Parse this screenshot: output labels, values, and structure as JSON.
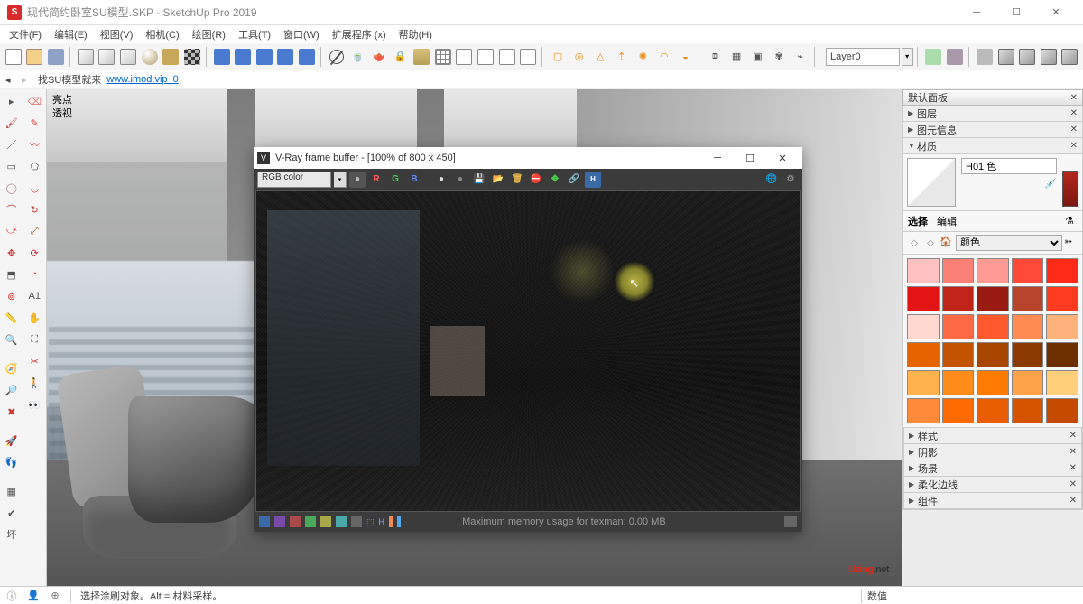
{
  "app": {
    "title": "现代简约卧室SU模型.SKP - SketchUp Pro 2019",
    "icon_letter": "S"
  },
  "menu": [
    "文件(F)",
    "编辑(E)",
    "视图(V)",
    "相机(C)",
    "绘图(R)",
    "工具(T)",
    "窗口(W)",
    "扩展程序 (x)",
    "帮助(H)"
  ],
  "toolbar1": {
    "layer_label": "Layer0"
  },
  "addr": {
    "prefix": "找SU模型就来",
    "url": "www.imod.vip_0"
  },
  "viewport": {
    "label_line1": "亮点",
    "label_line2": "透视",
    "watermark_prefix": "Uzing",
    "watermark_suffix": ".net"
  },
  "vfb": {
    "title": "V-Ray frame buffer - [100% of 800 x 450]",
    "channel": "RGB color",
    "rgb": [
      "R",
      "G",
      "B"
    ],
    "status": "Maximum memory usage for texman: 0.00 MB"
  },
  "panels": {
    "default_title": "默认面板",
    "sections_before_mat": [
      "图层",
      "图元信息"
    ],
    "material_title": "材质",
    "material_name": "H01 色",
    "tab_select": "选择",
    "tab_edit": "编辑",
    "palette_label": "颜色",
    "sections_after": [
      "样式",
      "阴影",
      "场景",
      "柔化边线",
      "组件"
    ]
  },
  "swatches": [
    "#ffc1c1",
    "#fb8176",
    "#ff9b94",
    "#ff4a3a",
    "#ff2a17",
    "#e31414",
    "#c02418",
    "#9a1b12",
    "#b8442c",
    "#ff3a1e",
    "#ffd8cf",
    "#ff6a45",
    "#ff5a2e",
    "#ff8a52",
    "#ffb37a",
    "#e66400",
    "#c45300",
    "#a84600",
    "#8a3a00",
    "#6e2f00",
    "#ffb24d",
    "#ff8c1a",
    "#ff7a00",
    "#ffa24a",
    "#ffcf7a",
    "#ff8a3a",
    "#ff6a00",
    "#e85e00",
    "#d65400",
    "#c44a00"
  ],
  "status": {
    "hint": "选择涂刷对象。Alt = 材料采样。",
    "measure_label": "数值"
  }
}
